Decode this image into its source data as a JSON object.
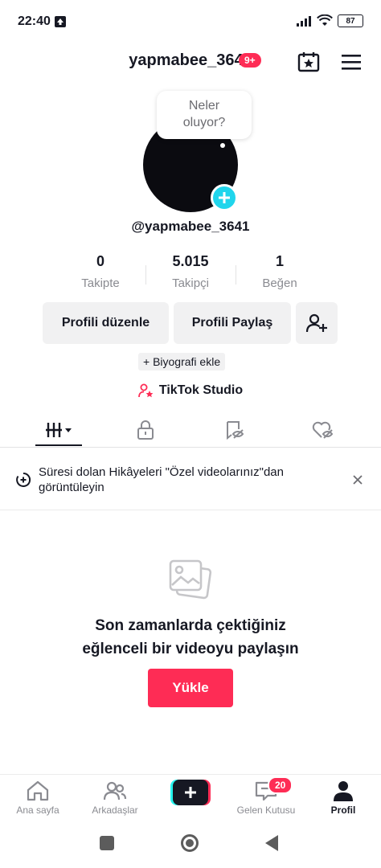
{
  "status_bar": {
    "time": "22:40",
    "battery": "87"
  },
  "header": {
    "username": "yapmabee_3641",
    "notification_badge": "9+"
  },
  "profile": {
    "bubble_line1": "Neler",
    "bubble_line2": "oluyor?",
    "handle": "@yapmabee_3641"
  },
  "stats": [
    {
      "value": "0",
      "label": "Takipte"
    },
    {
      "value": "5.015",
      "label": "Takipçi"
    },
    {
      "value": "1",
      "label": "Beğen"
    }
  ],
  "buttons": {
    "edit_profile": "Profili düzenle",
    "share_profile": "Profili Paylaş"
  },
  "bio_add": "+ Biyografi ekle",
  "studio": "TikTok Studio",
  "story_banner": {
    "text": "Süresi dolan Hikâyeleri \"Özel videolarınız\"dan görüntüleyin"
  },
  "empty_state": {
    "line1": "Son zamanlarda çektiğiniz",
    "line2": "eğlenceli bir videoyu paylaşın",
    "upload_label": "Yükle"
  },
  "bottom_nav": {
    "home": "Ana sayfa",
    "friends": "Arkadaşlar",
    "inbox": "Gelen Kutusu",
    "inbox_badge": "20",
    "profile": "Profil"
  },
  "colors": {
    "accent": "#fe2c55",
    "avatar_add": "#20d5ec"
  },
  "icons": [
    "upload-arrow-icon",
    "signal-icon",
    "wifi-icon",
    "battery-icon",
    "calendar-star-icon",
    "menu-icon",
    "plus-icon",
    "add-friend-icon",
    "studio-icon",
    "grid-icon",
    "lock-icon",
    "eye-off-icon",
    "heart-off-icon",
    "story-icon",
    "close-icon",
    "photo-icon",
    "home-icon",
    "friends-icon",
    "create-icon",
    "inbox-icon",
    "profile-icon"
  ]
}
